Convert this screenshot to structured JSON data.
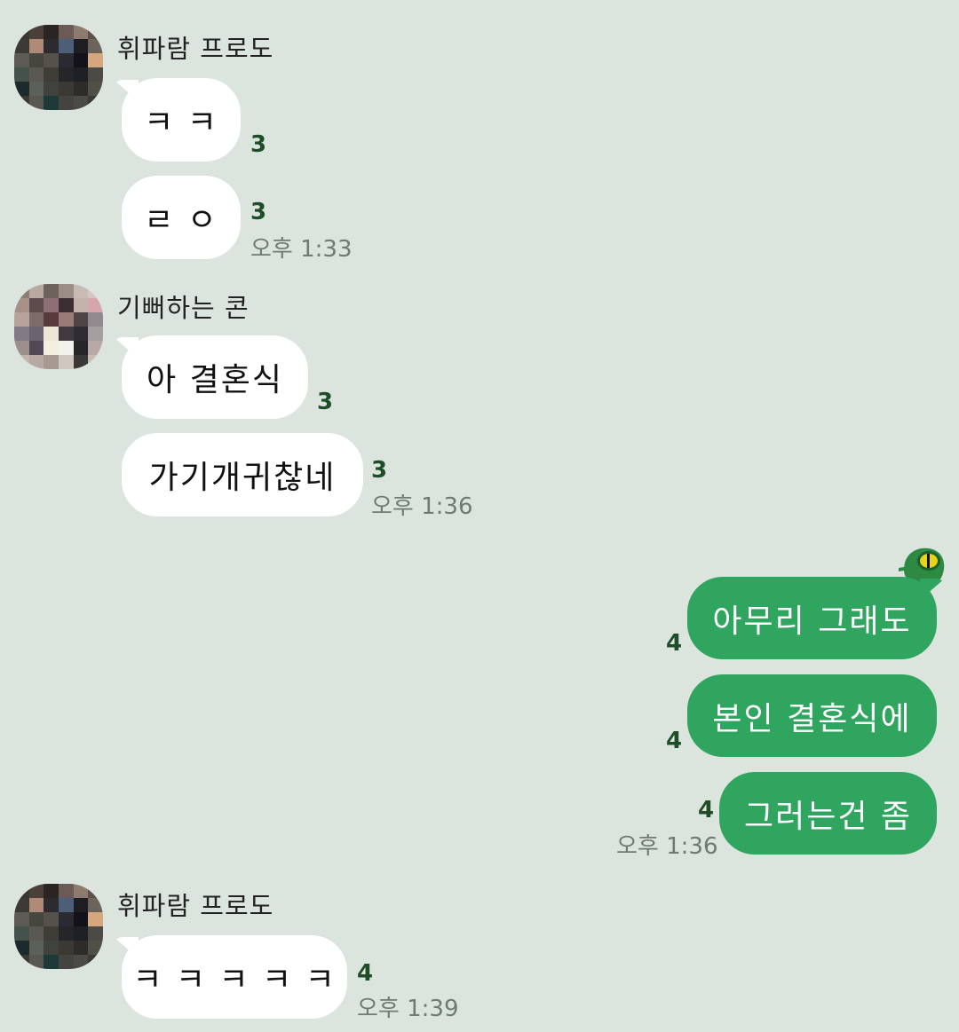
{
  "messages": [
    {
      "sender": "휘파람 프로도",
      "text": "ㅋ ㅋ",
      "unread": "3"
    },
    {
      "text": "ㄹ ㅇ",
      "unread": "3",
      "time": "오후 1:33"
    },
    {
      "sender": "기뻐하는 콘",
      "text": "아 결혼식",
      "unread": "3"
    },
    {
      "text": "가기개귀찮네",
      "unread": "3",
      "time": "오후 1:36"
    },
    {
      "text": "아무리 그래도",
      "unread": "4"
    },
    {
      "text": "본인 결혼식에",
      "unread": "4"
    },
    {
      "text": "그러는건 좀",
      "unread": "4",
      "time": "오후 1:36"
    },
    {
      "sender": "휘파람 프로도",
      "text": "ㅋ ㅋ ㅋ ㅋ ㅋ",
      "unread": "4",
      "time": "오후 1:39"
    }
  ],
  "avatars": {
    "frodo": [
      "#3a3630",
      "#4a3f39",
      "#2a2523",
      "#6b5b57",
      "#8f7a70",
      "#5a524d",
      "#3d3935",
      "#b08a76",
      "#2c2b2f",
      "#4d5f78",
      "#1d1d22",
      "#6d6459",
      "#5d5a54",
      "#464640",
      "#56524b",
      "#2b2a33",
      "#121218",
      "#d4a77c",
      "#45514d",
      "#5a5850",
      "#3f3d37",
      "#26252a",
      "#1f2024",
      "#4c4a44",
      "#1d2a2c",
      "#5b6059",
      "#40423d",
      "#3b3934",
      "#2d2c29",
      "#505047",
      "#3c3a35",
      "#5a5751",
      "#1e3a38",
      "#44433f",
      "#4b4a45",
      "#3a3935"
    ],
    "con": [
      "#8a7d74",
      "#b9a9a0",
      "#6e625c",
      "#9b8e84",
      "#c8bab5",
      "#d9c4c4",
      "#a88f88",
      "#5d4c4e",
      "#8f6f73",
      "#3b2f33",
      "#c4b3ad",
      "#d7a6ad",
      "#b7a39a",
      "#7c6d6b",
      "#5a3a3e",
      "#9b7b77",
      "#4e4646",
      "#8e8a8d",
      "#7f7a83",
      "#6a6470",
      "#eee6d4",
      "#3f3b3e",
      "#2f2d33",
      "#a39e9f",
      "#9c8f8c",
      "#4f4a55",
      "#f4eee0",
      "#f3f1ec",
      "#262528",
      "#b8a8a6",
      "#c2b5ae",
      "#b7a9a4",
      "#a89993",
      "#d0c6c0",
      "#3a3836",
      "#c9bbb4"
    ],
    "hidden_colors_note": ""
  },
  "emoji": "frog-sticker"
}
